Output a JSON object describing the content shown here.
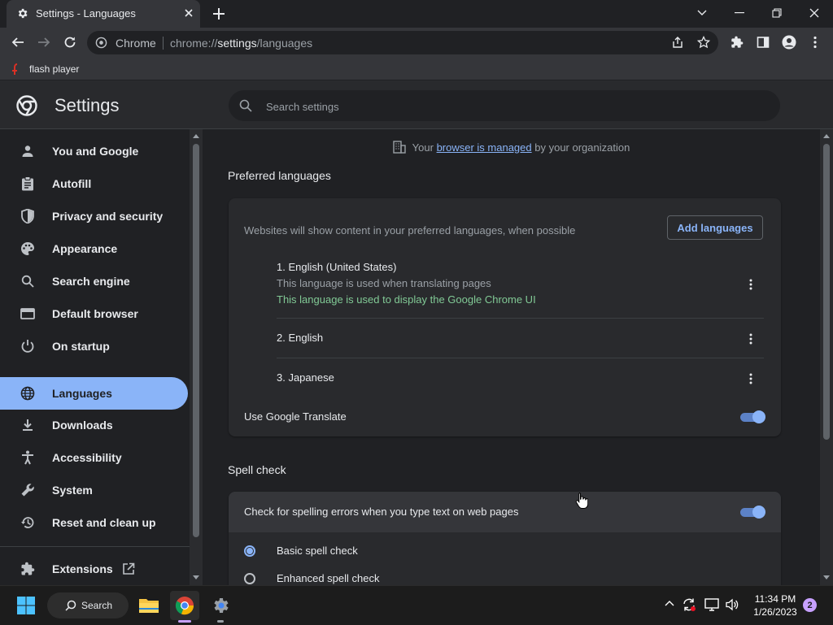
{
  "tab": {
    "title": "Settings - Languages",
    "icon": "gear-icon"
  },
  "toolbar": {
    "omnibox_site": "Chrome",
    "url_scheme": "chrome://",
    "url_host": "settings",
    "url_path": "/languages"
  },
  "bookmarks": [
    {
      "label": "flash player",
      "icon": "flash-icon"
    }
  ],
  "settings": {
    "title": "Settings",
    "search_placeholder": "Search settings"
  },
  "sidebar": {
    "items": [
      {
        "label": "You and Google",
        "icon": "person-icon"
      },
      {
        "label": "Autofill",
        "icon": "clipboard-icon"
      },
      {
        "label": "Privacy and security",
        "icon": "shield-icon"
      },
      {
        "label": "Appearance",
        "icon": "palette-icon"
      },
      {
        "label": "Search engine",
        "icon": "search-icon"
      },
      {
        "label": "Default browser",
        "icon": "browser-window-icon"
      },
      {
        "label": "On startup",
        "icon": "power-icon"
      },
      {
        "label": "Languages",
        "icon": "globe-icon",
        "active": true
      },
      {
        "label": "Downloads",
        "icon": "download-icon"
      },
      {
        "label": "Accessibility",
        "icon": "accessibility-icon"
      },
      {
        "label": "System",
        "icon": "wrench-icon"
      },
      {
        "label": "Reset and clean up",
        "icon": "history-icon"
      }
    ],
    "extensions": {
      "label": "Extensions",
      "icon": "puzzle-icon"
    }
  },
  "main": {
    "managed": {
      "prefix": "Your",
      "link": "browser is managed",
      "suffix": "by your organization"
    },
    "preferred": {
      "title": "Preferred languages",
      "description": "Websites will show content in your preferred languages, when possible",
      "add_button": "Add languages",
      "languages": [
        {
          "name": "1. English (United States)",
          "note1": "This language is used when translating pages",
          "note2": "This language is used to display the Google Chrome UI"
        },
        {
          "name": "2. English"
        },
        {
          "name": "3. Japanese"
        }
      ],
      "translate_label": "Use Google Translate",
      "translate_on": true
    },
    "spell": {
      "title": "Spell check",
      "toggle_label": "Check for spelling errors when you type text on web pages",
      "toggle_on": true,
      "options": [
        {
          "label": "Basic spell check",
          "selected": true
        },
        {
          "label": "Enhanced spell check",
          "selected": false
        }
      ]
    }
  },
  "taskbar": {
    "search_label": "Search",
    "time": "11:34 PM",
    "date": "1/26/2023",
    "notification_count": "2"
  },
  "colors": {
    "accent": "#8ab4f8",
    "green_note": "#81c995",
    "background": "#202124"
  }
}
